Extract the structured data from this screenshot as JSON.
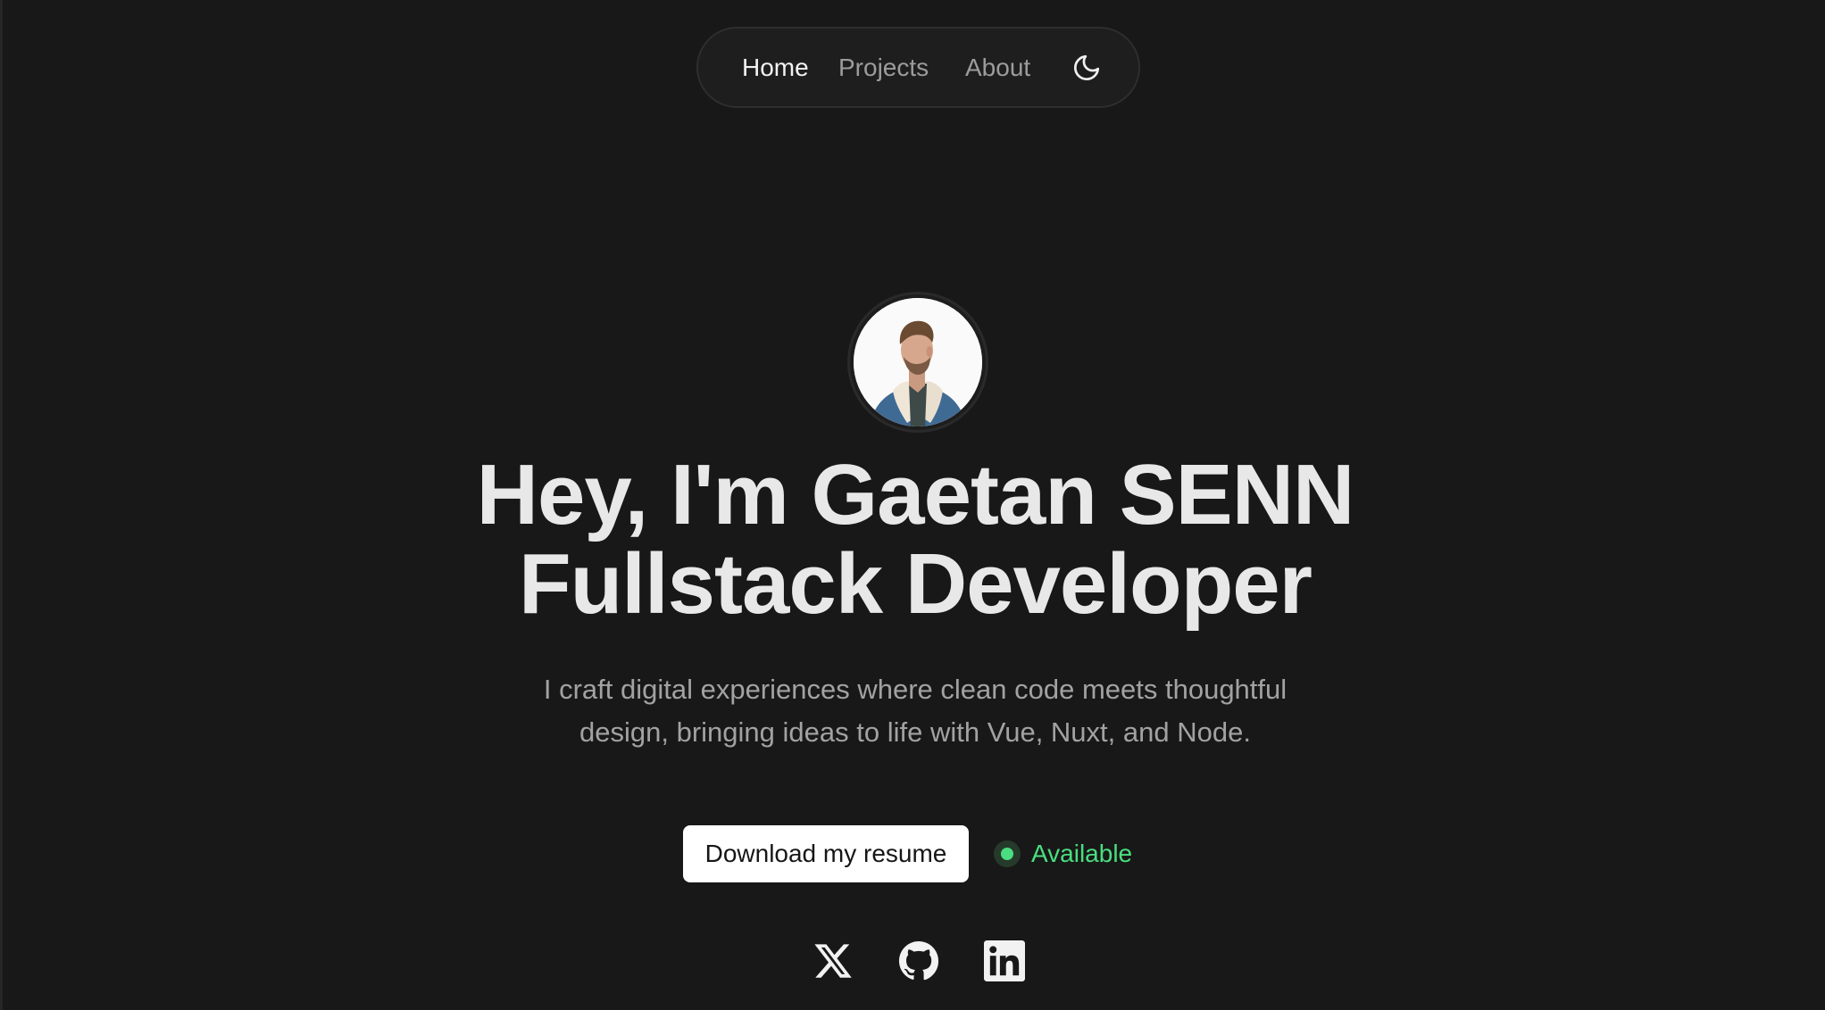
{
  "nav": {
    "items": [
      {
        "label": "Home",
        "active": true
      },
      {
        "label": "Projects",
        "active": false
      },
      {
        "label": "About",
        "active": false
      }
    ],
    "theme_toggle_icon": "moon-icon"
  },
  "hero": {
    "avatar_icon": "avatar",
    "headline_line1": "Hey, I'm Gaetan SENN",
    "headline_line2": "Fullstack Developer",
    "subtitle_line1": "I craft digital experiences where clean code meets thoughtful",
    "subtitle_line2": "design, bringing ideas to life with Vue, Nuxt, and Node.",
    "resume_button_label": "Download my resume",
    "status_label": "Available",
    "status_color": "#4ade80"
  },
  "socials": [
    {
      "icon": "x-icon"
    },
    {
      "icon": "github-icon"
    },
    {
      "icon": "linkedin-icon"
    }
  ],
  "colors": {
    "background": "#181818",
    "text_primary": "#e8e8e8",
    "text_muted": "#a2a2a2",
    "accent_green": "#4ade80"
  }
}
